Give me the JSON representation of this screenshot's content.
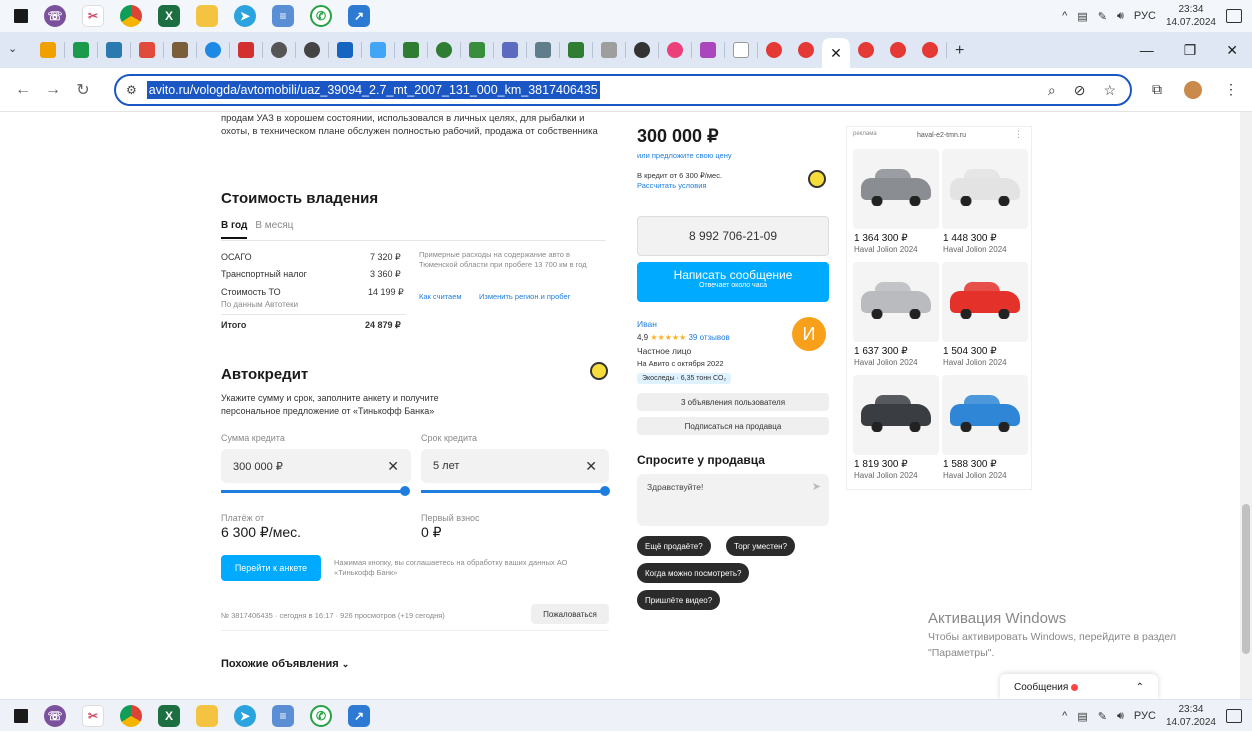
{
  "taskbar": {
    "tray": {
      "language": "РУС",
      "time": "23:34",
      "date": "14.07.2024"
    }
  },
  "browser": {
    "url": "avito.ru/vologda/avtomobili/uaz_39094_2.7_mt_2007_131_000_km_3817406435"
  },
  "listing": {
    "description": "продам УАЗ в хорошем состоянии, использовался в личных целях, для рыбалки и охоты, в техническом плане обслужен полностью рабочий, продажа от собственника",
    "ownership": {
      "title": "Стоимость владения",
      "tabs": [
        "В год",
        "В месяц"
      ],
      "rows": [
        {
          "label": "ОСАГО",
          "value": "7 320 ₽"
        },
        {
          "label": "Транспортный налог",
          "value": "3 360 ₽"
        },
        {
          "label": "Стоимость ТО",
          "value": "14 199 ₽"
        }
      ],
      "source": "По данным Автотеки",
      "total_label": "Итого",
      "total_value": "24 879 ₽",
      "note": "Примерные расходы на содержание авто в Тюменской области при пробеге 13 700 км в год",
      "link_calc": "Как считаем",
      "link_change": "Изменить регион и пробег"
    },
    "credit": {
      "title": "Автокредит",
      "desc": "Укажите сумму и срок, заполните анкету и получите персональное предложение от «Тинькофф Банка»",
      "amount_label": "Сумма кредита",
      "amount_value": "300 000 ₽",
      "term_label": "Срок кредита",
      "term_value": "5 лет",
      "amount_slider": 1.0,
      "term_slider": 1.0,
      "payment_label": "Платёж от",
      "payment_value": "6 300 ₽/мес.",
      "down_label": "Первый взнос",
      "down_value": "0 ₽",
      "button": "Перейти к анкете",
      "disclaimer": "Нажимая кнопку, вы соглашаетесь на обработку ваших данных АО «Тинькофф Банк»"
    },
    "footer_meta": "№ 3817406435 · сегодня в 16:17 · 926 просмотров (+19 сегодня)",
    "complain": "Пожаловаться",
    "similar": "Похожие объявления"
  },
  "seller_panel": {
    "price": "300 000 ₽",
    "propose": "или предложите свою цену",
    "credit_note": "В кредит от 6 300 ₽/мес.",
    "credit_link": "Рассчитать условия",
    "phone": "8 992 706-21-09",
    "write_btn": "Написать сообщение",
    "write_sub": "Отвечает около часа",
    "seller_name": "Иван",
    "rating": "4,9",
    "stars": "★★★★★",
    "reviews": "39 отзывов",
    "seller_type": "Частное лицо",
    "since": "На Авито с октября 2022",
    "avatar_letter": "И",
    "eco_badge": "Экоследы · 6,35 тонн CO₂",
    "user_ads": "3 объявления пользователя",
    "subscribe": "Подписаться на продавца",
    "ask_title": "Спросите у продавца",
    "ask_placeholder": "Здравствуйте!",
    "chips": [
      "Ещё продаёте?",
      "Торг уместен?",
      "Когда можно посмотреть?",
      "Пришлёте видео?"
    ]
  },
  "ads": {
    "label": "реклама",
    "brand": "haval-e2-tmn.ru",
    "cars": [
      {
        "price": "1 364 300 ₽",
        "model": "Haval Jolion 2024",
        "color": "#8a8d92"
      },
      {
        "price": "1 448 300 ₽",
        "model": "Haval Jolion 2024",
        "color": "#e3e3e3"
      },
      {
        "price": "1 637 300 ₽",
        "model": "Haval Jolion 2024",
        "color": "#b9bbbe"
      },
      {
        "price": "1 504 300 ₽",
        "model": "Haval Jolion 2024",
        "color": "#e4322b"
      },
      {
        "price": "1 819 300 ₽",
        "model": "Haval Jolion 2024",
        "color": "#3a3d42"
      },
      {
        "price": "1 588 300 ₽",
        "model": "Haval Jolion 2024",
        "color": "#2f86d6"
      }
    ]
  },
  "windows_activation": {
    "title": "Активация Windows",
    "text": "Чтобы активировать Windows, перейдите в раздел \"Параметры\"."
  },
  "messages_popup": {
    "label": "Сообщения"
  }
}
